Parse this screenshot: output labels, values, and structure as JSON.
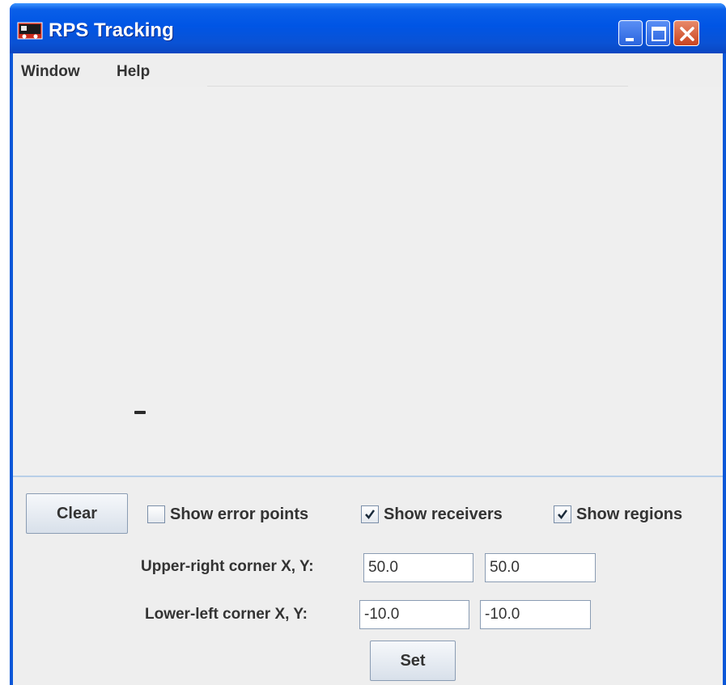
{
  "window": {
    "title": "RPS Tracking",
    "title_bar_color": "#0055e5",
    "icons": {
      "app": "train-icon",
      "minimize": "minimize-icon",
      "maximize": "maximize-icon",
      "close": "close-icon"
    }
  },
  "menubar": {
    "items": [
      {
        "label": "Window"
      },
      {
        "label": "Help"
      }
    ]
  },
  "controls": {
    "clear_label": "Clear",
    "set_label": "Set",
    "checkboxes": [
      {
        "label": "Show error points",
        "checked": false
      },
      {
        "label": "Show receivers",
        "checked": true
      },
      {
        "label": "Show regions",
        "checked": true
      }
    ],
    "upper_right": {
      "label": "Upper-right corner X, Y:",
      "x": "50.0",
      "y": "50.0"
    },
    "lower_left": {
      "label": "Lower-left corner X, Y:",
      "x": "-10.0",
      "y": "-10.0"
    }
  }
}
